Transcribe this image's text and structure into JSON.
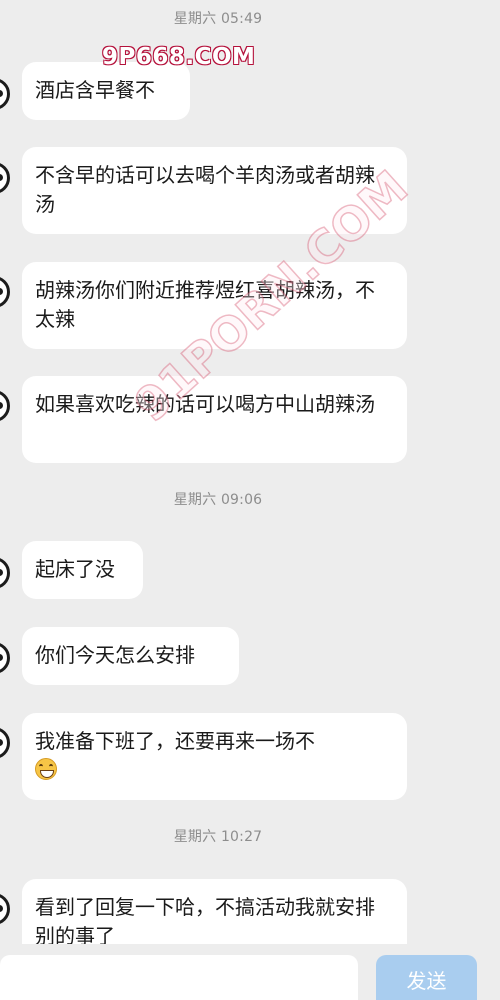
{
  "timestamps": [
    "星期六 05:49",
    "星期六 09:06",
    "星期六 10:27"
  ],
  "messages": [
    "酒店含早餐不",
    "不含早的话可以去喝个羊肉汤或者胡辣汤",
    "胡辣汤你们附近推荐煜红喜胡辣汤，不太辣",
    "如果喜欢吃辣的话可以喝方中山胡辣汤",
    "起床了没",
    "你们今天怎么安排",
    "我准备下班了，还要再来一场不",
    "看到了回复一下哈，不搞活动我就安排别的事了"
  ],
  "emoji": "grinning-face-emoji",
  "input": {
    "placeholder": "",
    "send_label": "发送"
  },
  "watermark": {
    "top": "9P668.COM",
    "diagonal": "91PORN.COM"
  },
  "colors": {
    "background": "#ededed",
    "bubble": "#ffffff",
    "send_button": "#a9cdef",
    "timestamp_text": "#8d8d8d"
  }
}
